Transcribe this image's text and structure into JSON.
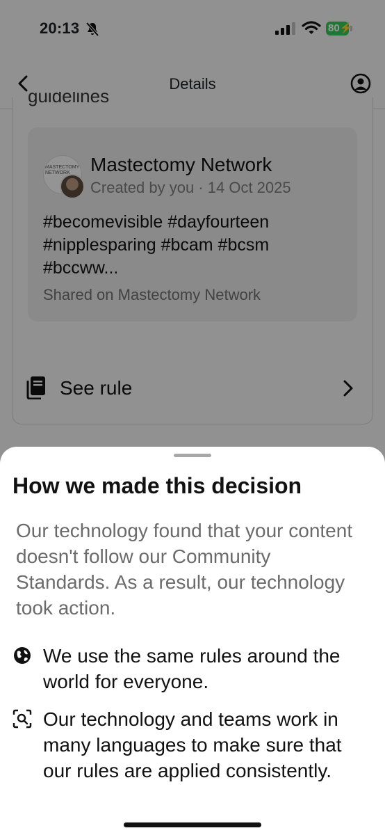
{
  "status_bar": {
    "time": "20:13",
    "battery": "80"
  },
  "nav": {
    "title": "Details"
  },
  "background": {
    "partial_text": "guidelines",
    "post": {
      "group_avatar_text": "MASTECTOMY NETWORK",
      "author": "Mastectomy Network",
      "meta": "Created by you · 14 Oct 2025",
      "text": "#becomevisible #dayfourteen #nipplesparing #bcam #bcsm #bccww...",
      "shared": "Shared on Mastectomy Network"
    },
    "see_rule_label": "See rule"
  },
  "sheet": {
    "title": "How we made this decision",
    "description": "Our technology found that your content doesn't follow our Community Standards. As a result, our technology took action.",
    "bullets": [
      {
        "icon": "globe-icon",
        "text": "We use the same rules around the world for everyone."
      },
      {
        "icon": "scan-search-icon",
        "text": "Our technology and teams work in many languages to make sure that our rules are applied consistently."
      }
    ]
  },
  "colors": {
    "battery": "#34c759",
    "overlay": "rgba(0,0,0,0.40)"
  }
}
